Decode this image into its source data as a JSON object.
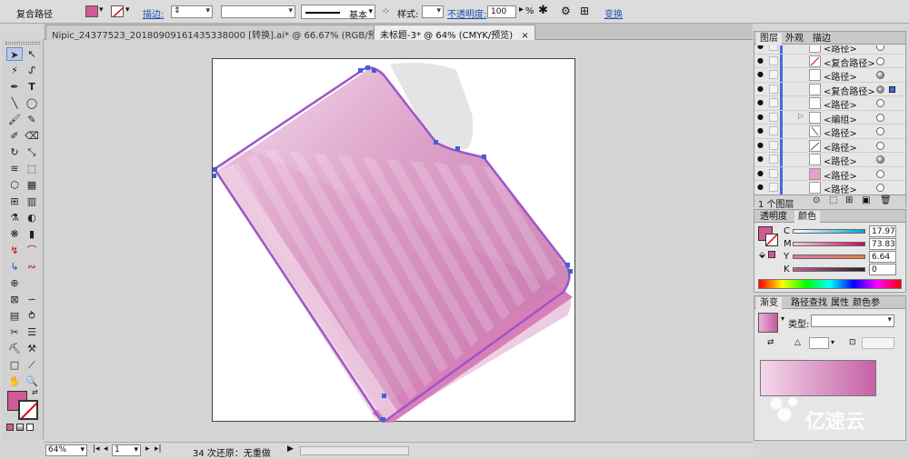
{
  "control_bar": {
    "object_type": "复合路径",
    "stroke_label": "描边:",
    "stroke_style": "基本",
    "style_label": "样式:",
    "opacity_label": "不透明度:",
    "opacity_value": "100",
    "opacity_unit": "%",
    "transform_label": "变换",
    "fill_color": "#d05a96"
  },
  "tabs": [
    {
      "label": "Nipic_24377523_20180909161435338000 [转换].ai* @ 66.67% (RGB/预览)"
    },
    {
      "label": "未标题-3* @ 64% (CMYK/预览)",
      "close": "×"
    }
  ],
  "status": {
    "zoom": "64%",
    "page": "1",
    "undo_info": "34 次还原：无重做"
  },
  "layers_panel": {
    "tabs": [
      "图层",
      "外观",
      "描边"
    ],
    "items": [
      {
        "name": "<路径>",
        "target": "empty"
      },
      {
        "name": "<复合路径>",
        "target": "empty"
      },
      {
        "name": "<路径>",
        "target": "filled"
      },
      {
        "name": "<复合路径>",
        "target": "double"
      },
      {
        "name": "<路径>",
        "target": "empty"
      },
      {
        "name": "<编组>",
        "target": "empty"
      },
      {
        "name": "<路径>",
        "target": "empty"
      },
      {
        "name": "<路径>",
        "target": "empty"
      },
      {
        "name": "<路径>",
        "target": "filled"
      },
      {
        "name": "<路径>",
        "target": "empty"
      },
      {
        "name": "<路径>",
        "target": "empty"
      }
    ],
    "footer": "1 个图层"
  },
  "color_panel": {
    "tabs": [
      "透明度",
      "颜色"
    ],
    "channels": [
      {
        "label": "C",
        "value": "17.97"
      },
      {
        "label": "M",
        "value": "73.83"
      },
      {
        "label": "Y",
        "value": "6.64"
      },
      {
        "label": "K",
        "value": "0"
      }
    ],
    "fill_color": "#d05a96"
  },
  "gradient_panel": {
    "tabs": [
      "渐变",
      "路径查找",
      "属性",
      "颜色参"
    ],
    "type_label": "类型:",
    "percent_unit": "%"
  },
  "watermark": "亿速云"
}
